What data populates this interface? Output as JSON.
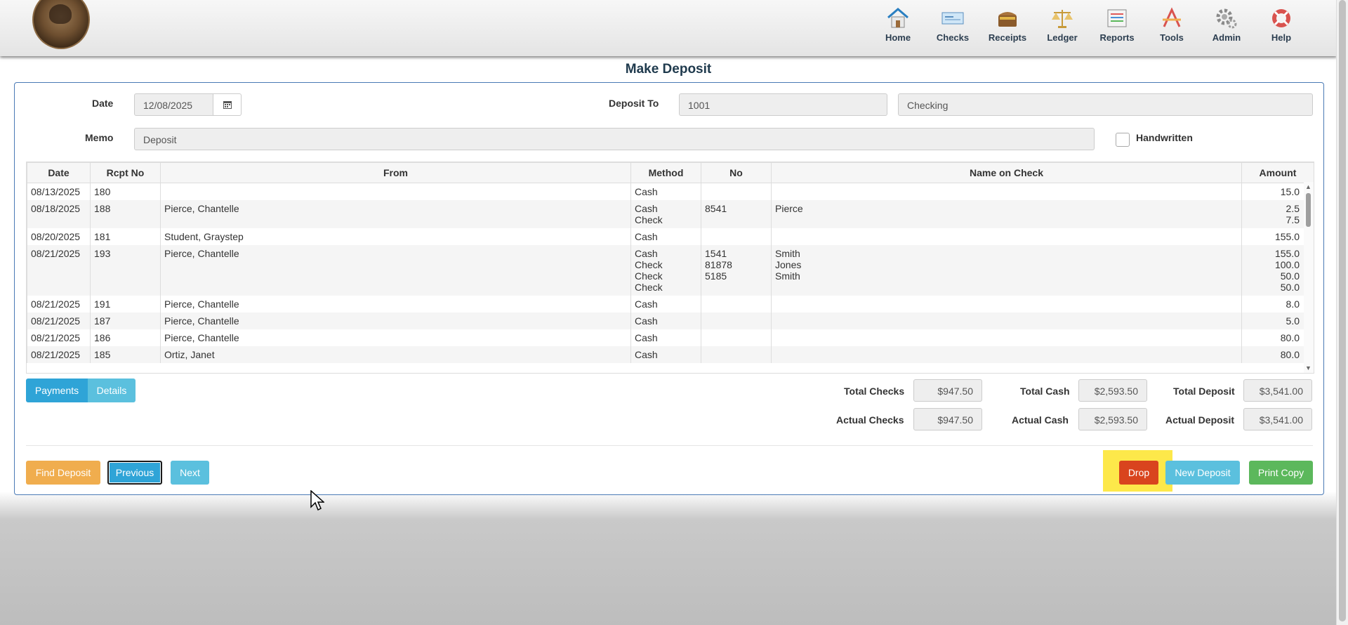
{
  "nav": {
    "items": [
      {
        "label": "Home",
        "icon": "home-icon"
      },
      {
        "label": "Checks",
        "icon": "checks-icon"
      },
      {
        "label": "Receipts",
        "icon": "receipts-icon"
      },
      {
        "label": "Ledger",
        "icon": "ledger-icon"
      },
      {
        "label": "Reports",
        "icon": "reports-icon"
      },
      {
        "label": "Tools",
        "icon": "tools-icon"
      },
      {
        "label": "Admin",
        "icon": "admin-icon"
      },
      {
        "label": "Help",
        "icon": "help-icon"
      }
    ]
  },
  "page": {
    "title": "Make Deposit"
  },
  "form": {
    "date_label": "Date",
    "date_value": "12/08/2025",
    "deposit_to_label": "Deposit To",
    "account_number": "1001",
    "account_name": "Checking",
    "memo_label": "Memo",
    "memo_value": "Deposit",
    "handwritten_label": "Handwritten"
  },
  "table": {
    "headers": [
      "Date",
      "Rcpt No",
      "From",
      "Method",
      "No",
      "Name on Check",
      "Amount"
    ],
    "rows": [
      {
        "date": "08/13/2025",
        "rcpt": "180",
        "from": "",
        "methods": [
          "Cash"
        ],
        "nos": [],
        "names": [],
        "amounts": [
          "15.0"
        ]
      },
      {
        "date": "08/18/2025",
        "rcpt": "188",
        "from": "Pierce, Chantelle",
        "methods": [
          "Cash",
          "Check"
        ],
        "nos": [
          "8541"
        ],
        "names": [
          "Pierce"
        ],
        "amounts": [
          "2.5",
          "7.5"
        ]
      },
      {
        "date": "08/20/2025",
        "rcpt": "181",
        "from": "Student, Graystep",
        "methods": [
          "Cash"
        ],
        "nos": [],
        "names": [],
        "amounts": [
          "155.0"
        ]
      },
      {
        "date": "08/21/2025",
        "rcpt": "193",
        "from": "Pierce, Chantelle",
        "methods": [
          "Cash",
          "Check",
          "Check",
          "Check"
        ],
        "nos": [
          "1541",
          "81878",
          "5185"
        ],
        "names": [
          "Smith",
          "Jones",
          "Smith"
        ],
        "amounts": [
          "155.0",
          "100.0",
          "50.0",
          "50.0"
        ]
      },
      {
        "date": "08/21/2025",
        "rcpt": "191",
        "from": "Pierce, Chantelle",
        "methods": [
          "Cash"
        ],
        "nos": [],
        "names": [],
        "amounts": [
          "8.0"
        ]
      },
      {
        "date": "08/21/2025",
        "rcpt": "187",
        "from": "Pierce, Chantelle",
        "methods": [
          "Cash"
        ],
        "nos": [],
        "names": [],
        "amounts": [
          "5.0"
        ]
      },
      {
        "date": "08/21/2025",
        "rcpt": "186",
        "from": "Pierce, Chantelle",
        "methods": [
          "Cash"
        ],
        "nos": [],
        "names": [],
        "amounts": [
          "80.0"
        ]
      },
      {
        "date": "08/21/2025",
        "rcpt": "185",
        "from": "Ortiz, Janet",
        "methods": [
          "Cash"
        ],
        "nos": [],
        "names": [],
        "amounts": [
          "80.0"
        ]
      }
    ]
  },
  "tabs": {
    "payments": "Payments",
    "details": "Details"
  },
  "totals": {
    "total_checks_label": "Total Checks",
    "total_checks": "$947.50",
    "total_cash_label": "Total Cash",
    "total_cash": "$2,593.50",
    "total_deposit_label": "Total Deposit",
    "total_deposit": "$3,541.00",
    "actual_checks_label": "Actual Checks",
    "actual_checks": "$947.50",
    "actual_cash_label": "Actual Cash",
    "actual_cash": "$2,593.50",
    "actual_deposit_label": "Actual Deposit",
    "actual_deposit": "$3,541.00"
  },
  "buttons": {
    "find_deposit": "Find Deposit",
    "previous": "Previous",
    "next": "Next",
    "drop": "Drop",
    "new_deposit": "New Deposit",
    "print_copy": "Print Copy"
  },
  "colors": {
    "orange": "#f0ad4e",
    "blue": "#5bc0de",
    "primary": "#2fa4d7",
    "drop": "#d9441e",
    "green": "#5cb85c",
    "highlight": "#fde84a"
  }
}
